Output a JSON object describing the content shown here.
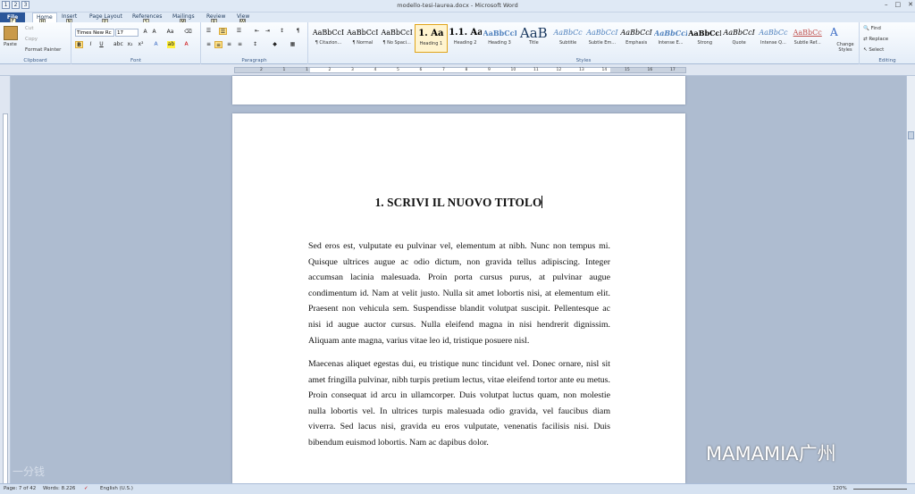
{
  "window": {
    "title": "modello-tesi-laurea.docx - Microsoft Word",
    "controls": [
      "–",
      "□",
      "✕"
    ]
  },
  "qat": [
    "1",
    "2",
    "3"
  ],
  "tabs": [
    {
      "label": "File",
      "key": "F"
    },
    {
      "label": "Home",
      "key": "H"
    },
    {
      "label": "Insert",
      "key": "N"
    },
    {
      "label": "Page Layout",
      "key": "P"
    },
    {
      "label": "References",
      "key": "S"
    },
    {
      "label": "Mailings",
      "key": "M"
    },
    {
      "label": "Review",
      "key": "R"
    },
    {
      "label": "View",
      "key": "W"
    }
  ],
  "clipboard": {
    "paste": "Paste",
    "cut": "Cut",
    "copy": "Copy",
    "format_painter": "Format Painter",
    "label": "Clipboard"
  },
  "font": {
    "name": "Times New Rc",
    "size": "17",
    "label": "Font"
  },
  "paragraph": {
    "label": "Paragraph"
  },
  "styles": {
    "label": "Styles",
    "items": [
      {
        "preview": "AaBbCcI",
        "name": "¶ Citazion..."
      },
      {
        "preview": "AaBbCcI",
        "name": "¶ Normal"
      },
      {
        "preview": "AaBbCcI",
        "name": "¶ No Spaci..."
      },
      {
        "preview": "1.  Aa",
        "name": "Heading 1"
      },
      {
        "preview": "1.1.  Aa",
        "name": "Heading 2"
      },
      {
        "preview": "AaBbCcI",
        "name": "Heading 3"
      },
      {
        "preview": "AaB",
        "name": "Title"
      },
      {
        "preview": "AaBbCc",
        "name": "Subtitle"
      },
      {
        "preview": "AaBbCcI",
        "name": "Subtle Em..."
      },
      {
        "preview": "AaBbCcI",
        "name": "Emphasis"
      },
      {
        "preview": "AaBbCcI",
        "name": "Intense E..."
      },
      {
        "preview": "AaBbCcI",
        "name": "Strong"
      },
      {
        "preview": "AaBbCcI",
        "name": "Quote"
      },
      {
        "preview": "AaBbCc",
        "name": "Intense Q..."
      },
      {
        "preview": "AaBbCc",
        "name": "Subtle Ref..."
      }
    ],
    "change_styles": "Change Styles"
  },
  "editing": {
    "find": "Find",
    "replace": "Replace",
    "select": "Select",
    "label": "Editing"
  },
  "ruler": {
    "ticks": [
      "2",
      "1",
      "1",
      "2",
      "3",
      "4",
      "5",
      "6",
      "7",
      "8",
      "9",
      "10",
      "11",
      "12",
      "13",
      "14",
      "15",
      "16",
      "17"
    ]
  },
  "document": {
    "heading": "1. SCRIVI IL NUOVO TITOLO",
    "para1": "Sed eros est, vulputate eu pulvinar vel, elementum at nibh. Nunc non tempus mi. Quisque ultrices augue ac odio dictum, non gravida tellus adipiscing. Integer accumsan lacinia malesuada. Proin porta cursus purus, at pulvinar augue condimentum id. Nam at velit justo. Nulla sit amet lobortis nisi, at elementum elit. Praesent non vehicula sem. Suspendisse blandit volutpat suscipit. Pellentesque ac nisi id augue auctor cursus. Nulla eleifend magna in nisi hendrerit dignissim. Aliquam ante magna, varius vitae leo id, tristique posuere nisl.",
    "para2": "Maecenas aliquet egestas dui, eu tristique nunc tincidunt vel. Donec ornare, nisl sit amet fringilla pulvinar, nibh turpis pretium lectus, vitae eleifend tortor ante eu metus. Proin consequat id arcu in ullamcorper. Duis volutpat luctus quam, non molestie nulla lobortis vel. In ultrices turpis malesuada odio gravida, vel faucibus diam viverra. Sed lacus nisi, gravida eu eros vulputate, venenatis facilisis nisi. Duis bibendum euismod lobortis. Nam ac dapibus dolor."
  },
  "status": {
    "page": "Page: 7 of 42",
    "words": "Words: 8.226",
    "language": "English (U.S.)",
    "zoom": "120%"
  },
  "watermark": {
    "right": "MAMAMIA广州",
    "left": "一分钱"
  }
}
